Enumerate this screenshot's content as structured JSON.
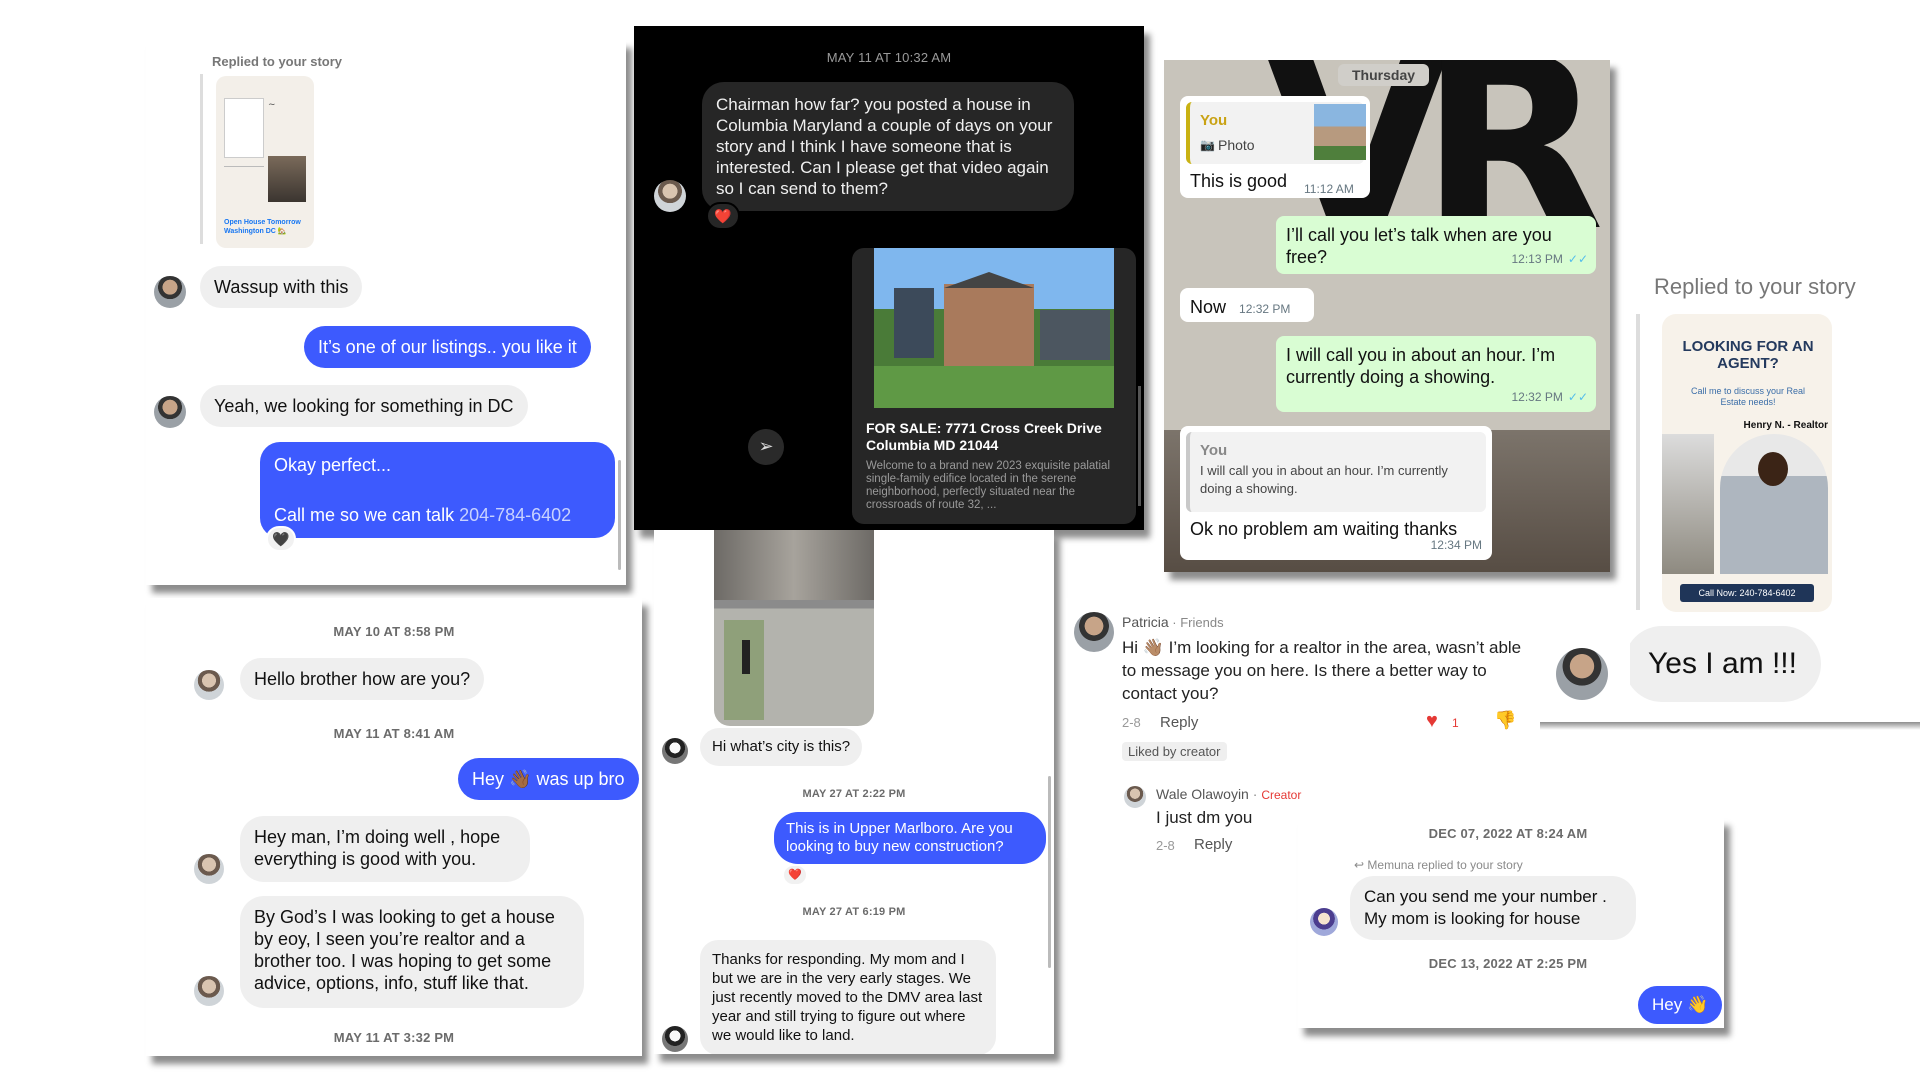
{
  "panel_a": {
    "replied_label": "Replied to your story",
    "story": {
      "banner_line1": "Open House Tomorrow",
      "banner_line2": "Washington DC 🏡"
    },
    "msg1": "Wassup with this",
    "msg2": "It’s one of our listings.. you like it",
    "msg3": "Yeah, we looking for something in DC",
    "msg4_line1": "Okay perfect...",
    "msg4_line2_prefix": "Call me so we can talk ",
    "msg4_phone": "204-784-6402",
    "reaction": "🖤"
  },
  "panel_b": {
    "timestamp": "MAY 11 AT 10:32 AM",
    "incoming_msg": "Chairman how far? you posted a house  in Columbia Maryland a couple of days on your story and I think I have someone that is interested. Can I please get that video again so I can send to them?",
    "reaction": "❤️",
    "listing_title": "FOR SALE: 7771 Cross Creek Drive Columbia MD 21044",
    "listing_desc": "Welcome to a brand new 2023 exquisite palatial single-family edifice located in the serene neighborhood, perfectly situated near the crossroads of route 32, ..."
  },
  "panel_c": {
    "day_label": "Thursday",
    "quote_sender": "You",
    "quote_type": "Photo",
    "msg1": "This is good",
    "msg1_time": "11:12 AM",
    "msg2": "I’ll call you let’s talk when are you free?",
    "msg2_time": "12:13 PM",
    "msg3": "Now",
    "msg3_time": "12:32 PM",
    "msg4": "I will call you in about an hour. I’m currently doing a showing.",
    "msg4_time": "12:32 PM",
    "quote2_sender": "You",
    "quote2_text": "I will call you in about an hour. I’m currently doing a showing.",
    "msg5": "Ok no problem am waiting thanks",
    "msg5_time": "12:34 PM",
    "tick": "✓✓"
  },
  "panel_d": {
    "replied_label": "Replied to your story",
    "story_headline": "LOOKING FOR AN AGENT?",
    "story_sub": "Call me to discuss your Real Estate needs!",
    "story_name": "Henry N. - Realtor",
    "story_footer": "Call Now: 240-784-6402",
    "reply": "Yes I am !!!"
  },
  "panel_e": {
    "stamp1": "MAY 10 AT 8:58 PM",
    "msg1": "Hello brother how are you?",
    "stamp2": "MAY 11 AT 8:41 AM",
    "msg2_pre": "Hey ",
    "msg2_emoji": "👋🏾",
    "msg2_post": " was up bro",
    "msg3": "Hey man, I’m doing well , hope everything is good with you.",
    "msg4": "By God’s I was looking to get a house by eoy, I seen you’re realtor and a brother too. I was hoping to get some advice, options, info, stuff like that.",
    "stamp3": "MAY 11 AT 3:32 PM"
  },
  "panel_f": {
    "msg1": "Hi what’s city is this?",
    "stamp1": "MAY 27 AT 2:22 PM",
    "msg2": "This is in Upper Marlboro. Are you looking to buy new construction?",
    "reaction": "❤️",
    "stamp2": "MAY 27 AT 6:19 PM",
    "msg3": "Thanks for responding. My mom and I but we are in the very early stages. We just recently moved to the DMV area last year and still trying to figure out where we would like to land."
  },
  "panel_g": {
    "commenter": "Patricia",
    "commenter_tag": " · Friends",
    "comment": "Hi 👋🏽 I’m looking for a realtor in the area, wasn’t able to message you on here. Is there a better way to contact you?",
    "comment_age": "2-8",
    "reply_label": "Reply",
    "like_count": "1",
    "liked_badge": "Liked by creator",
    "creator_name": "Wale Olawoyin",
    "creator_tag": "Creator",
    "creator_reply": "I just dm you",
    "creator_age": "2-8",
    "creator_reply_label": "Reply"
  },
  "panel_h": {
    "stamp1": "DEC 07, 2022 AT 8:24 AM",
    "replied_note": "Memuna replied to your story",
    "msg1": "Can you send me your number . My mom is looking for house",
    "stamp2": "DEC 13, 2022 AT 2:25 PM",
    "msg2": "Hey 👋"
  },
  "colors": {
    "ig_blue": "#3d5afe",
    "wa_out": "#d9fdd3",
    "wa_tick": "#53bdeb",
    "creator_red": "#e53935"
  }
}
